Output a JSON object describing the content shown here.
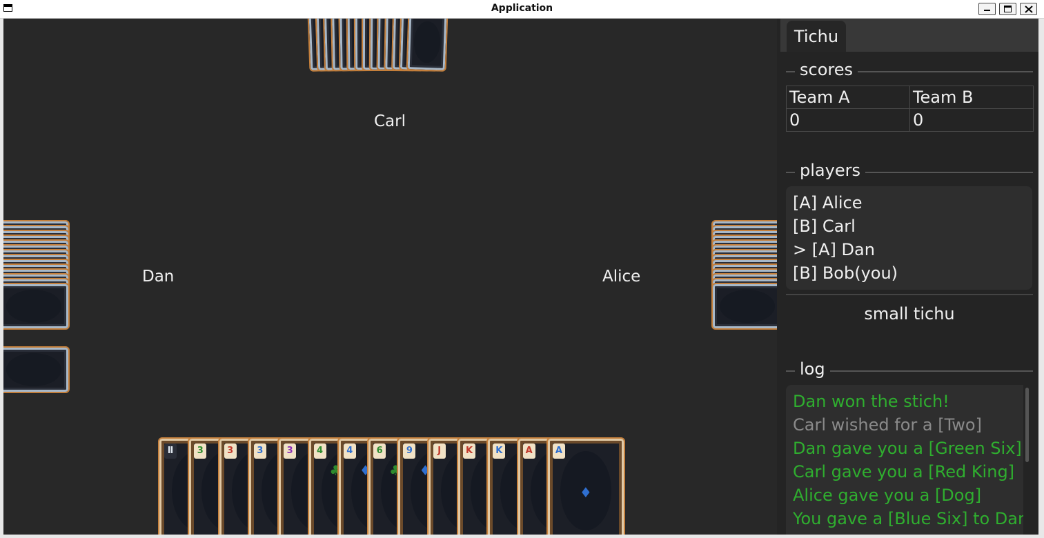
{
  "window": {
    "title": "Application"
  },
  "table": {
    "players": {
      "top": "Carl",
      "left": "Dan",
      "right": "Alice"
    }
  },
  "hand": [
    {
      "rank": "",
      "pip": "",
      "color": "#2a2a2a",
      "special": "mahjong-icon"
    },
    {
      "rank": "3",
      "pip": "",
      "color": "#2e8b2e"
    },
    {
      "rank": "3",
      "pip": "",
      "color": "#c0392b"
    },
    {
      "rank": "3",
      "pip": "",
      "color": "#2f6fd0"
    },
    {
      "rank": "3",
      "pip": "",
      "color": "#8a2fb5"
    },
    {
      "rank": "4",
      "pip": "♣",
      "color": "#2e8b2e"
    },
    {
      "rank": "4",
      "pip": "♦",
      "color": "#2f6fd0"
    },
    {
      "rank": "6",
      "pip": "♣",
      "color": "#2e8b2e"
    },
    {
      "rank": "9",
      "pip": "♦",
      "color": "#2f6fd0"
    },
    {
      "rank": "J",
      "pip": "",
      "color": "#c0392b"
    },
    {
      "rank": "K",
      "pip": "",
      "color": "#c0392b"
    },
    {
      "rank": "K",
      "pip": "",
      "color": "#2f6fd0"
    },
    {
      "rank": "A",
      "pip": "",
      "color": "#c0392b"
    },
    {
      "rank": "A",
      "pip": "♦",
      "color": "#2f6fd0"
    }
  ],
  "panel": {
    "tab": "Tichu",
    "scores_label": "scores",
    "teams": [
      "Team A",
      "Team B"
    ],
    "team_scores": [
      "0",
      "0"
    ],
    "players_label": "players",
    "players": [
      "[A] Alice",
      "[B] Carl",
      "> [A] Dan",
      "[B] Bob(you)"
    ],
    "action_button": "small tichu",
    "log_label": "log",
    "log": [
      {
        "text": "Dan won the stich!",
        "color": "#2fae2f"
      },
      {
        "text": "Carl wished for a [Two]",
        "color": "#8a8a8a"
      },
      {
        "text": "Dan gave you a [Green Six]",
        "color": "#2fae2f"
      },
      {
        "text": "Carl gave you a [Red King]",
        "color": "#2fae2f"
      },
      {
        "text": "Alice gave you a [Dog]",
        "color": "#2fae2f"
      },
      {
        "text": "You gave a [Blue Six] to Dan",
        "color": "#2fae2f"
      }
    ]
  }
}
